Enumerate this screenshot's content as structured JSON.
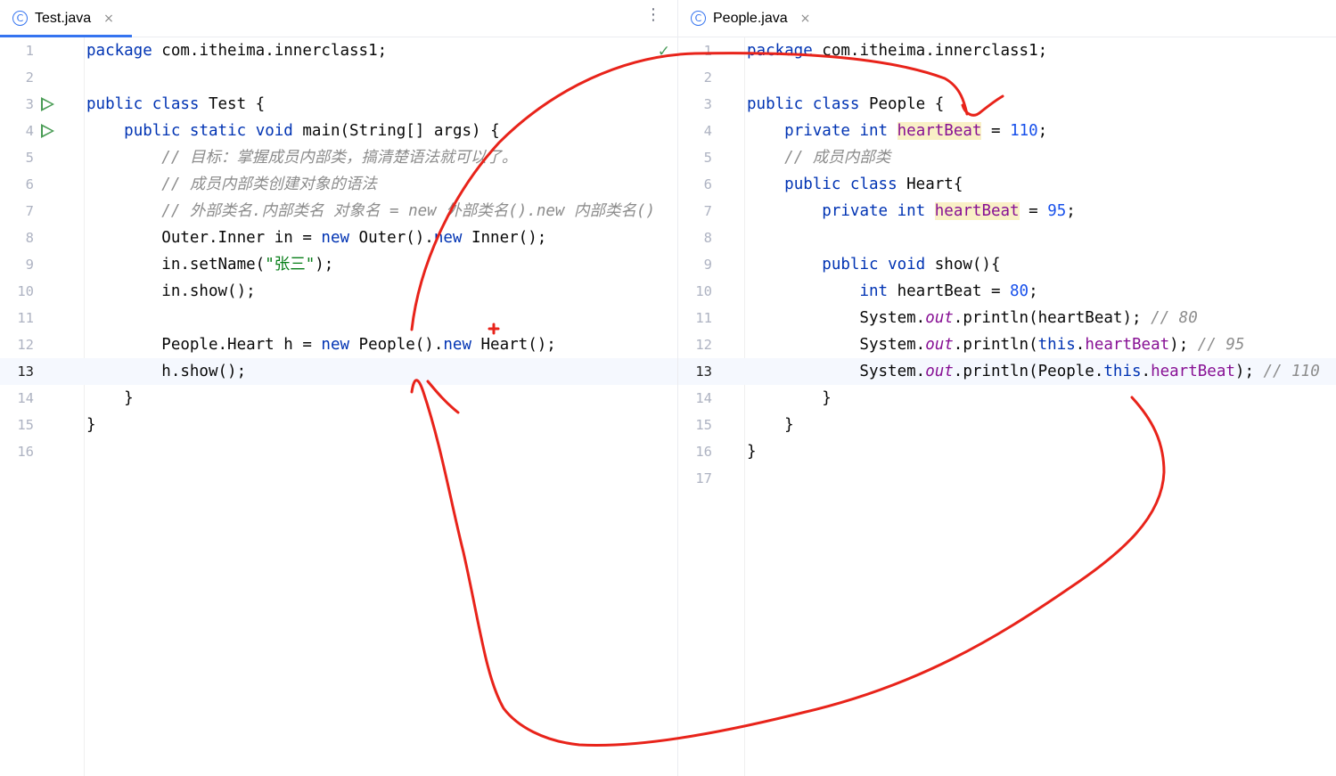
{
  "left": {
    "tab": {
      "icon": "class-icon",
      "icon_glyph": "C",
      "label": "Test.java",
      "close": "×"
    },
    "menu_glyph": "⋮",
    "lines": [
      {
        "n": "1",
        "segs": [
          {
            "t": "package",
            "c": "kw"
          },
          {
            "t": " com.itheima.innerclass1;"
          }
        ]
      },
      {
        "n": "2",
        "segs": []
      },
      {
        "n": "3",
        "run": true,
        "segs": [
          {
            "t": "public",
            "c": "kw"
          },
          {
            "t": " "
          },
          {
            "t": "class",
            "c": "kw"
          },
          {
            "t": " Test {"
          }
        ]
      },
      {
        "n": "4",
        "run": true,
        "segs": [
          {
            "t": "    "
          },
          {
            "t": "public",
            "c": "kw"
          },
          {
            "t": " "
          },
          {
            "t": "static",
            "c": "kw"
          },
          {
            "t": " "
          },
          {
            "t": "void",
            "c": "kw"
          },
          {
            "t": " main(String[] args) {"
          }
        ]
      },
      {
        "n": "5",
        "segs": [
          {
            "t": "        "
          },
          {
            "t": "// 目标：掌握成员内部类，搞清楚语法就可以了。",
            "c": "cmt"
          }
        ]
      },
      {
        "n": "6",
        "segs": [
          {
            "t": "        "
          },
          {
            "t": "// 成员内部类创建对象的语法",
            "c": "cmt"
          }
        ]
      },
      {
        "n": "7",
        "segs": [
          {
            "t": "        "
          },
          {
            "t": "// 外部类名.内部类名 对象名 = new 外部类名().new 内部类名()",
            "c": "cmt"
          }
        ]
      },
      {
        "n": "8",
        "segs": [
          {
            "t": "        Outer.Inner in = "
          },
          {
            "t": "new",
            "c": "kw"
          },
          {
            "t": " Outer()."
          },
          {
            "t": "new",
            "c": "kw"
          },
          {
            "t": " Inner();"
          }
        ]
      },
      {
        "n": "9",
        "segs": [
          {
            "t": "        in.setName("
          },
          {
            "t": "\"张三\"",
            "c": "str"
          },
          {
            "t": ");"
          }
        ]
      },
      {
        "n": "10",
        "segs": [
          {
            "t": "        in.show();"
          }
        ]
      },
      {
        "n": "11",
        "segs": []
      },
      {
        "n": "12",
        "segs": [
          {
            "t": "        People.Heart h = "
          },
          {
            "t": "new",
            "c": "kw"
          },
          {
            "t": " People()."
          },
          {
            "t": "new",
            "c": "kw"
          },
          {
            "t": " Heart();"
          }
        ]
      },
      {
        "n": "13",
        "current": true,
        "segs": [
          {
            "t": "        h.show();"
          }
        ]
      },
      {
        "n": "14",
        "segs": [
          {
            "t": "    }"
          }
        ]
      },
      {
        "n": "15",
        "segs": [
          {
            "t": "}"
          }
        ]
      },
      {
        "n": "16",
        "segs": []
      }
    ]
  },
  "right": {
    "tab": {
      "icon": "class-icon",
      "icon_glyph": "C",
      "label": "People.java",
      "close": "×"
    },
    "lines": [
      {
        "n": "1",
        "segs": [
          {
            "t": "package",
            "c": "kw"
          },
          {
            "t": " com.itheima.innerclass1;"
          }
        ]
      },
      {
        "n": "2",
        "segs": []
      },
      {
        "n": "3",
        "segs": [
          {
            "t": "public",
            "c": "kw"
          },
          {
            "t": " "
          },
          {
            "t": "class",
            "c": "kw"
          },
          {
            "t": " People {"
          }
        ]
      },
      {
        "n": "4",
        "segs": [
          {
            "t": "    "
          },
          {
            "t": "private",
            "c": "kw"
          },
          {
            "t": " "
          },
          {
            "t": "int",
            "c": "kw"
          },
          {
            "t": " "
          },
          {
            "t": "heartBeat",
            "c": "fld hl"
          },
          {
            "t": " = "
          },
          {
            "t": "110",
            "c": "num"
          },
          {
            "t": ";"
          }
        ]
      },
      {
        "n": "5",
        "segs": [
          {
            "t": "    "
          },
          {
            "t": "// 成员内部类",
            "c": "cmt"
          }
        ]
      },
      {
        "n": "6",
        "segs": [
          {
            "t": "    "
          },
          {
            "t": "public",
            "c": "kw"
          },
          {
            "t": " "
          },
          {
            "t": "class",
            "c": "kw"
          },
          {
            "t": " Heart{"
          }
        ]
      },
      {
        "n": "7",
        "segs": [
          {
            "t": "        "
          },
          {
            "t": "private",
            "c": "kw"
          },
          {
            "t": " "
          },
          {
            "t": "int",
            "c": "kw"
          },
          {
            "t": " "
          },
          {
            "t": "heartBeat",
            "c": "fld hl"
          },
          {
            "t": " = "
          },
          {
            "t": "95",
            "c": "num"
          },
          {
            "t": ";"
          }
        ]
      },
      {
        "n": "8",
        "segs": []
      },
      {
        "n": "9",
        "segs": [
          {
            "t": "        "
          },
          {
            "t": "public",
            "c": "kw"
          },
          {
            "t": " "
          },
          {
            "t": "void",
            "c": "kw"
          },
          {
            "t": " show(){"
          }
        ]
      },
      {
        "n": "10",
        "segs": [
          {
            "t": "            "
          },
          {
            "t": "int",
            "c": "kw"
          },
          {
            "t": " heartBeat = "
          },
          {
            "t": "80",
            "c": "num"
          },
          {
            "t": ";"
          }
        ]
      },
      {
        "n": "11",
        "segs": [
          {
            "t": "            System."
          },
          {
            "t": "out",
            "c": "st"
          },
          {
            "t": ".println(heartBeat); "
          },
          {
            "t": "// 80",
            "c": "cmt"
          }
        ]
      },
      {
        "n": "12",
        "segs": [
          {
            "t": "            System."
          },
          {
            "t": "out",
            "c": "st"
          },
          {
            "t": ".println("
          },
          {
            "t": "this",
            "c": "kw"
          },
          {
            "t": "."
          },
          {
            "t": "heartBeat",
            "c": "fld"
          },
          {
            "t": "); "
          },
          {
            "t": "// 95",
            "c": "cmt"
          }
        ]
      },
      {
        "n": "13",
        "current": true,
        "segs": [
          {
            "t": "            System."
          },
          {
            "t": "out",
            "c": "st"
          },
          {
            "t": ".println(People."
          },
          {
            "t": "this",
            "c": "kw"
          },
          {
            "t": "."
          },
          {
            "t": "heartBeat",
            "c": "fld"
          },
          {
            "t": "); "
          },
          {
            "t": "// 110",
            "c": "cmt"
          }
        ]
      },
      {
        "n": "14",
        "segs": [
          {
            "t": "        }"
          }
        ]
      },
      {
        "n": "15",
        "segs": [
          {
            "t": "    }"
          }
        ]
      },
      {
        "n": "16",
        "segs": [
          {
            "t": "}"
          }
        ]
      },
      {
        "n": "17",
        "segs": []
      }
    ]
  },
  "annotation_color": "#e8231a",
  "check_glyph": "✓"
}
